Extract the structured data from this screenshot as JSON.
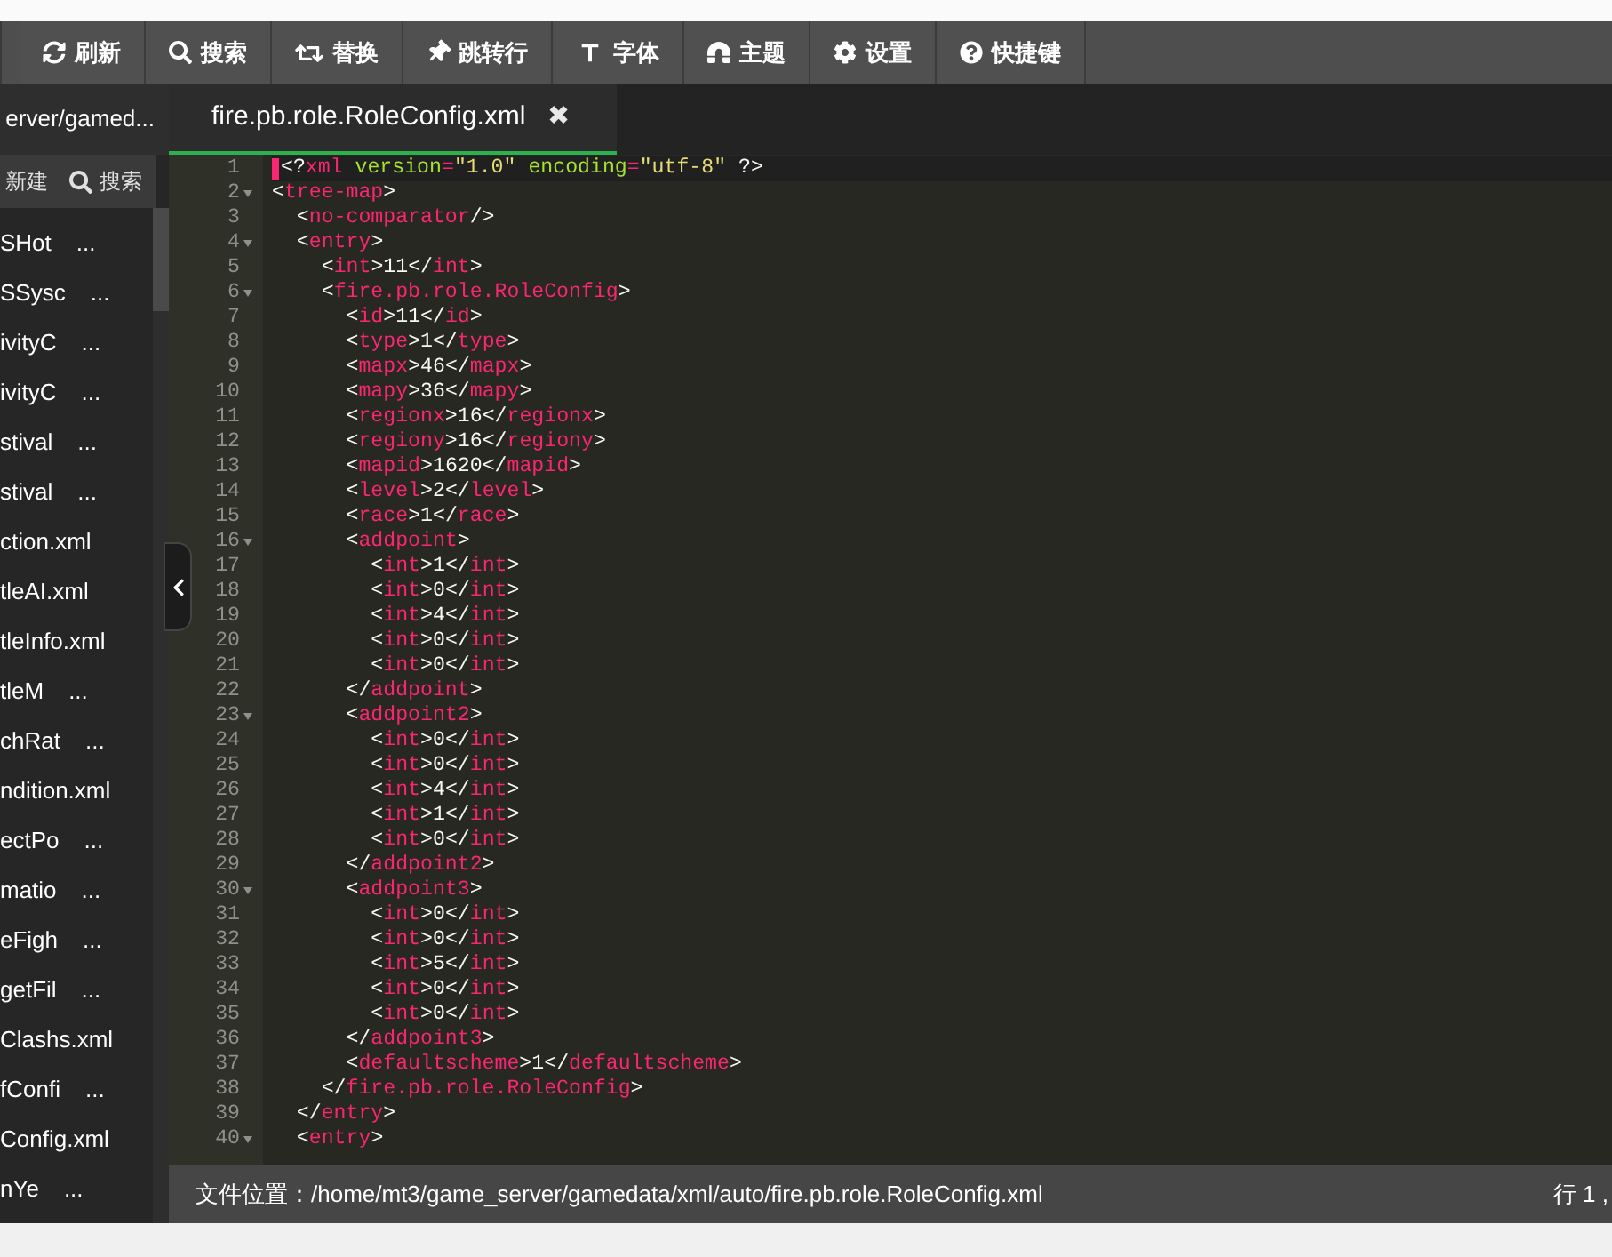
{
  "toolbar": [
    {
      "label": "刷新"
    },
    {
      "label": "搜索"
    },
    {
      "label": "替换"
    },
    {
      "label": "跳转行"
    },
    {
      "label": "字体"
    },
    {
      "label": "主题"
    },
    {
      "label": "设置"
    },
    {
      "label": "快捷键"
    }
  ],
  "sidebar": {
    "path": "erver/gamed...",
    "actions": [
      {
        "label": "新建"
      },
      {
        "label": "搜索"
      }
    ],
    "files": [
      {
        "name": "SHot",
        "more": "..."
      },
      {
        "name": "SSysc",
        "more": "..."
      },
      {
        "name": "ivityC",
        "more": "..."
      },
      {
        "name": "ivityC",
        "more": "..."
      },
      {
        "name": "stival",
        "more": "..."
      },
      {
        "name": "stival",
        "more": "..."
      },
      {
        "name": "ction.xml"
      },
      {
        "name": "tleAI.xml"
      },
      {
        "name": "tleInfo.xml"
      },
      {
        "name": "tleM",
        "more": "..."
      },
      {
        "name": "chRat",
        "more": "..."
      },
      {
        "name": "ndition.xml"
      },
      {
        "name": "ectPo",
        "more": "..."
      },
      {
        "name": "matio",
        "more": "..."
      },
      {
        "name": "eFigh",
        "more": "..."
      },
      {
        "name": "getFil",
        "more": "..."
      },
      {
        "name": "Clashs.xml"
      },
      {
        "name": "fConfi",
        "more": "..."
      },
      {
        "name": "Config.xml"
      },
      {
        "name": "nYe",
        "more": "..."
      }
    ]
  },
  "tab": {
    "title": "fire.pb.role.RoleConfig.xml",
    "close": "✖",
    "selected": true
  },
  "lines": [
    {
      "number": "1",
      "text": "<?xml version=\"1.0\" encoding=\"utf-8\" ?>",
      "fold": false
    },
    {
      "number": "2",
      "text": "<tree-map>",
      "fold": true
    },
    {
      "number": "3",
      "text": "  <no-comparator/>",
      "fold": false
    },
    {
      "number": "4",
      "text": "  <entry>",
      "fold": true
    },
    {
      "number": "5",
      "text": "    <int>11</int>",
      "fold": false
    },
    {
      "number": "6",
      "text": "    <fire.pb.role.RoleConfig>",
      "fold": true
    },
    {
      "number": "7",
      "text": "      <id>11</id>",
      "fold": false
    },
    {
      "number": "8",
      "text": "      <type>1</type>",
      "fold": false
    },
    {
      "number": "9",
      "text": "      <mapx>46</mapx>",
      "fold": false
    },
    {
      "number": "10",
      "text": "      <mapy>36</mapy>",
      "fold": false
    },
    {
      "number": "11",
      "text": "      <regionx>16</regionx>",
      "fold": false
    },
    {
      "number": "12",
      "text": "      <regiony>16</regiony>",
      "fold": false
    },
    {
      "number": "13",
      "text": "      <mapid>1620</mapid>",
      "fold": false
    },
    {
      "number": "14",
      "text": "      <level>2</level>",
      "fold": false
    },
    {
      "number": "15",
      "text": "      <race>1</race>",
      "fold": false
    },
    {
      "number": "16",
      "text": "      <addpoint>",
      "fold": true
    },
    {
      "number": "17",
      "text": "        <int>1</int>",
      "fold": false
    },
    {
      "number": "18",
      "text": "        <int>0</int>",
      "fold": false
    },
    {
      "number": "19",
      "text": "        <int>4</int>",
      "fold": false
    },
    {
      "number": "20",
      "text": "        <int>0</int>",
      "fold": false
    },
    {
      "number": "21",
      "text": "        <int>0</int>",
      "fold": false
    },
    {
      "number": "22",
      "text": "      </addpoint>",
      "fold": false
    },
    {
      "number": "23",
      "text": "      <addpoint2>",
      "fold": true
    },
    {
      "number": "24",
      "text": "        <int>0</int>",
      "fold": false
    },
    {
      "number": "25",
      "text": "        <int>0</int>",
      "fold": false
    },
    {
      "number": "26",
      "text": "        <int>4</int>",
      "fold": false
    },
    {
      "number": "27",
      "text": "        <int>1</int>",
      "fold": false
    },
    {
      "number": "28",
      "text": "        <int>0</int>",
      "fold": false
    },
    {
      "number": "29",
      "text": "      </addpoint2>",
      "fold": false
    },
    {
      "number": "30",
      "text": "      <addpoint3>",
      "fold": true
    },
    {
      "number": "31",
      "text": "        <int>0</int>",
      "fold": false
    },
    {
      "number": "32",
      "text": "        <int>0</int>",
      "fold": false
    },
    {
      "number": "33",
      "text": "        <int>5</int>",
      "fold": false
    },
    {
      "number": "34",
      "text": "        <int>0</int>",
      "fold": false
    },
    {
      "number": "35",
      "text": "        <int>0</int>",
      "fold": false
    },
    {
      "number": "36",
      "text": "      </addpoint3>",
      "fold": false
    },
    {
      "number": "37",
      "text": "      <defaultscheme>1</defaultscheme>",
      "fold": false
    },
    {
      "number": "38",
      "text": "    </fire.pb.role.RoleConfig>",
      "fold": false
    },
    {
      "number": "39",
      "text": "  </entry>",
      "fold": false
    },
    {
      "number": "40",
      "text": "  <entry>",
      "fold": true
    }
  ],
  "status_bar": {
    "path": "文件位置：/home/mt3/game_server/gamedata/xml/auto/fire.pb.role.RoleConfig.xml",
    "position": "行 1 ,"
  }
}
